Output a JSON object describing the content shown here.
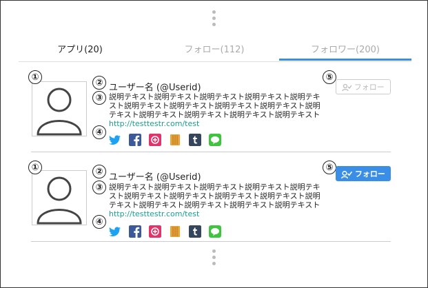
{
  "tabs": [
    {
      "label": "アプリ(20)"
    },
    {
      "label": "フォロー(112)"
    },
    {
      "label": "フォロワー(200)"
    }
  ],
  "cards": [
    {
      "markers": [
        "①",
        "②",
        "③",
        "④",
        "⑤"
      ],
      "name": "ユーザー名 (@Userid)",
      "description": "説明テキスト説明テキスト説明テキスト説明テキスト説明テキスト説明テキスト説明テキスト説明テキスト説明テキスト説明テキスト説明テキスト説明テキスト説明テキスト説明テキスト",
      "link": "http://testtestr.com/test",
      "follow_label": "フォロー",
      "follow_state": "off"
    },
    {
      "markers": [
        "①",
        "②",
        "③",
        "④",
        "⑤"
      ],
      "name": "ユーザー名 (@Userid)",
      "description": "説明テキスト説明テキスト説明テキスト説明テキスト説明テキスト説明テキスト説明テキスト説明テキスト説明テキスト説明テキスト説明テキスト説明テキスト説明テキスト説明テキスト",
      "link": "http://testtestr.com/test",
      "follow_label": "フォロー",
      "follow_state": "on"
    }
  ],
  "social_icons": [
    "twitter-icon",
    "facebook-icon",
    "app-icon",
    "amazon-icon",
    "tumblr-icon",
    "line-icon"
  ],
  "colors": {
    "accent": "#3a8ee6",
    "twitter": "#1da1f2",
    "facebook": "#3b5998",
    "pink": "#e0356a",
    "amazon": "#e8a33a",
    "tumblr": "#35465c",
    "line": "#3ec43e",
    "link": "#1a9e8f"
  }
}
